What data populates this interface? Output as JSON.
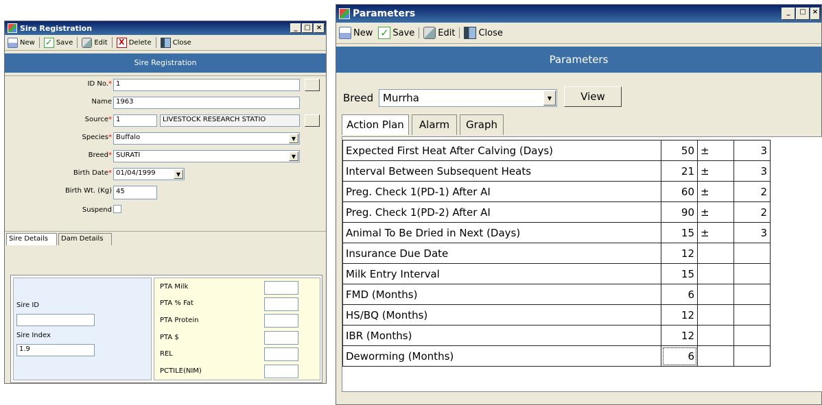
{
  "sire": {
    "title": "Sire Registration",
    "toolbar": {
      "new": "New",
      "save": "Save",
      "edit": "Edit",
      "delete": "Delete",
      "close": "Close"
    },
    "header": "Sire Registration",
    "labels": {
      "id": "ID No.",
      "name": "Name",
      "source": "Source",
      "species": "Species",
      "breed": "Breed",
      "birth_date": "Birth Date",
      "birth_wt": "Birth Wt. (Kg)",
      "suspend": "Suspend"
    },
    "values": {
      "id": "1",
      "name": "1963",
      "source_code": "1",
      "source_name": "LIVESTOCK RESEARCH STATIO",
      "species": "Buffalo",
      "breed": "SURATI",
      "birth_date": "01/04/1999",
      "birth_wt": "45"
    },
    "tabs": [
      "Sire Details",
      "Dam Details"
    ],
    "details": {
      "sire_id_label": "Sire ID",
      "sire_id_value": "",
      "sire_index_label": "Sire Index",
      "sire_index_value": "1.9"
    },
    "pta": [
      "PTA Milk",
      "PTA % Fat",
      "PTA Protein",
      "PTA $",
      "REL",
      "PCTILE(NIM)"
    ]
  },
  "params": {
    "title": "Parameters",
    "toolbar": {
      "new": "New",
      "save": "Save",
      "edit": "Edit",
      "close": "Close"
    },
    "header": "Parameters",
    "breed_label": "Breed",
    "breed_value": "Murrha",
    "view_button": "View",
    "tabs": [
      "Action Plan",
      "Alarm",
      "Graph"
    ],
    "rows": [
      {
        "label": "Expected First Heat After Calving (Days)",
        "value": "50",
        "pm": "±",
        "tol": "3"
      },
      {
        "label": "Interval Between Subsequent Heats",
        "value": "21",
        "pm": "±",
        "tol": "3"
      },
      {
        "label": "Preg. Check 1(PD-1) After AI",
        "value": "60",
        "pm": "±",
        "tol": "2"
      },
      {
        "label": "Preg. Check 1(PD-2) After AI",
        "value": "90",
        "pm": "±",
        "tol": "2"
      },
      {
        "label": "Animal To Be Dried in Next (Days)",
        "value": "15",
        "pm": "±",
        "tol": "3"
      },
      {
        "label": "Insurance Due Date",
        "value": "12",
        "pm": "",
        "tol": ""
      },
      {
        "label": "Milk Entry Interval",
        "value": "15",
        "pm": "",
        "tol": ""
      },
      {
        "label": "FMD (Months)",
        "value": "6",
        "pm": "",
        "tol": ""
      },
      {
        "label": "HS/BQ (Months)",
        "value": "12",
        "pm": "",
        "tol": ""
      },
      {
        "label": "IBR (Months)",
        "value": "12",
        "pm": "",
        "tol": ""
      },
      {
        "label": "Deworming (Months)",
        "value": "6",
        "pm": "",
        "tol": ""
      }
    ]
  },
  "window_buttons": {
    "minimize": "_",
    "maximize": "□",
    "close": "×"
  }
}
